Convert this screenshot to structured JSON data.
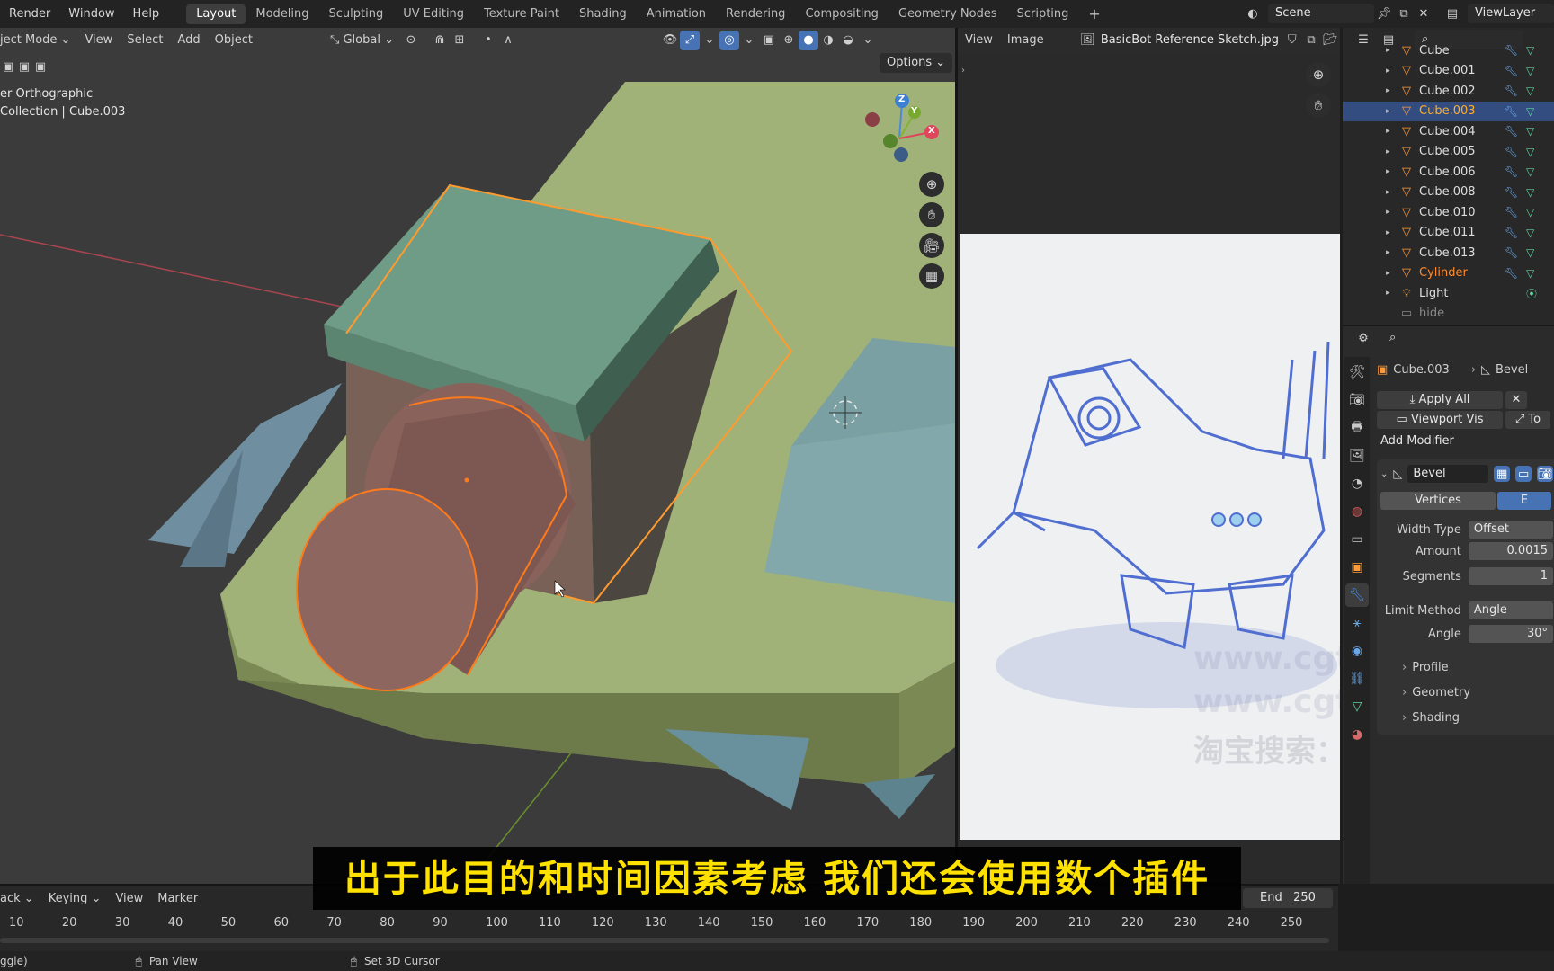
{
  "topbar": {
    "menus": [
      "Render",
      "Window",
      "Help"
    ],
    "workspaces": [
      "Layout",
      "Modeling",
      "Sculpting",
      "UV Editing",
      "Texture Paint",
      "Shading",
      "Animation",
      "Rendering",
      "Compositing",
      "Geometry Nodes",
      "Scripting"
    ],
    "active_workspace": "Layout",
    "scene": "Scene",
    "view_layer": "ViewLayer"
  },
  "viewport": {
    "mode": "ject Mode",
    "menus": [
      "View",
      "Select",
      "Add",
      "Object"
    ],
    "orientation": "Global",
    "options_label": "Options",
    "view_name": "er Orthographic",
    "collection_info": "Collection | Cube.003",
    "gizmo_axes": [
      "Z",
      "Y",
      "X"
    ]
  },
  "image_editor": {
    "menus": [
      "View",
      "Image"
    ],
    "image_name": "BasicBot Reference Sketch.jpg"
  },
  "outliner": {
    "items": [
      {
        "name": "Cube",
        "type": "mesh"
      },
      {
        "name": "Cube.001",
        "type": "mesh"
      },
      {
        "name": "Cube.002",
        "type": "mesh"
      },
      {
        "name": "Cube.003",
        "type": "mesh",
        "selected": true
      },
      {
        "name": "Cube.004",
        "type": "mesh"
      },
      {
        "name": "Cube.005",
        "type": "mesh"
      },
      {
        "name": "Cube.006",
        "type": "mesh"
      },
      {
        "name": "Cube.008",
        "type": "mesh"
      },
      {
        "name": "Cube.010",
        "type": "mesh"
      },
      {
        "name": "Cube.011",
        "type": "mesh"
      },
      {
        "name": "Cube.013",
        "type": "mesh"
      },
      {
        "name": "Cylinder",
        "type": "mesh",
        "active": true
      },
      {
        "name": "Light",
        "type": "light"
      },
      {
        "name": "hide",
        "type": "collection"
      }
    ]
  },
  "properties": {
    "object": "Cube.003",
    "modifier_path": "Bevel",
    "apply_all": "Apply All",
    "viewport_vis": "Viewport Vis",
    "toggle_label": "To",
    "add_modifier": "Add Modifier",
    "modifier": {
      "name": "Bevel",
      "affect_tabs": [
        "Vertices",
        "E"
      ],
      "fields": [
        {
          "label": "Width Type",
          "value": "Offset"
        },
        {
          "label": "Amount",
          "value": "0.0015"
        },
        {
          "label": "Segments",
          "value": "1"
        },
        {
          "label": "Limit Method",
          "value": "Angle"
        },
        {
          "label": "Angle",
          "value": "30°"
        }
      ],
      "panels": [
        "Profile",
        "Geometry",
        "Shading"
      ]
    }
  },
  "timeline": {
    "menus": [
      "ack",
      "Keying",
      "View",
      "Marker"
    ],
    "end_label": "End",
    "end_value": "250",
    "frame_ticks": [
      "10",
      "20",
      "30",
      "40",
      "50",
      "60",
      "70",
      "80",
      "90",
      "100",
      "110",
      "120",
      "130",
      "140",
      "150",
      "160",
      "170",
      "180",
      "190",
      "200",
      "210",
      "220",
      "230",
      "240",
      "250"
    ]
  },
  "statusbar": {
    "left": "ggle)",
    "pan_view": "Pan View",
    "set_cursor": "Set 3D Cursor"
  },
  "subtitle": "出于此目的和时间因素考虑  我们还会使用数个插件",
  "watermarks": [
    "淘宝搜索：青之巅字幕组",
    "www.cgtg.c",
    "www.cgtg.c"
  ],
  "colors": {
    "selection_blue": "#334d80",
    "active_orange": "#ff8a2b",
    "header_blue": "#4772b3",
    "subtitle_yellow": "#ffe100"
  }
}
